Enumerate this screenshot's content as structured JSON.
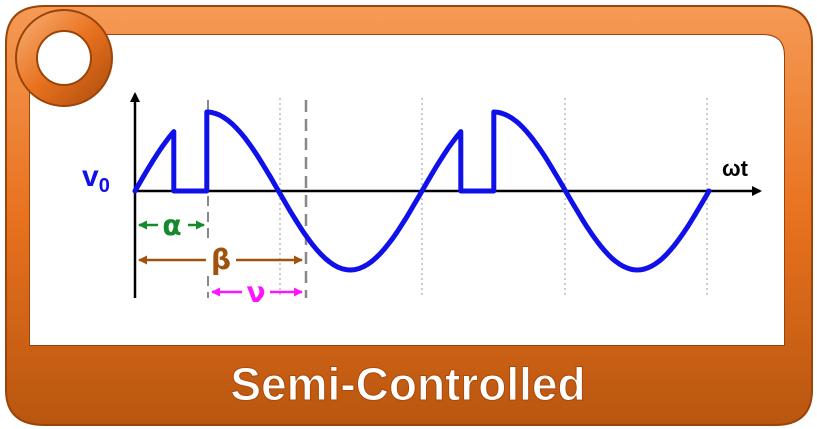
{
  "labels": {
    "output_voltage": "v",
    "output_voltage_sub": "0",
    "time_axis": "ωt",
    "firing_angle": "α",
    "extinction_angle": "β",
    "conduction_angle": "ν"
  },
  "caption": "Semi-Controlled",
  "colors": {
    "frame": "#e8721f",
    "frame_dark": "#a94a0b",
    "frame_light": "#f6a564",
    "waveform": "#1010e8",
    "alpha": "#148a2c",
    "beta": "#a0520f",
    "nu": "#ff14ff",
    "axis": "#000000",
    "caption_text": "#ffffff"
  },
  "icons": [
    "hang-hole-icon"
  ]
}
